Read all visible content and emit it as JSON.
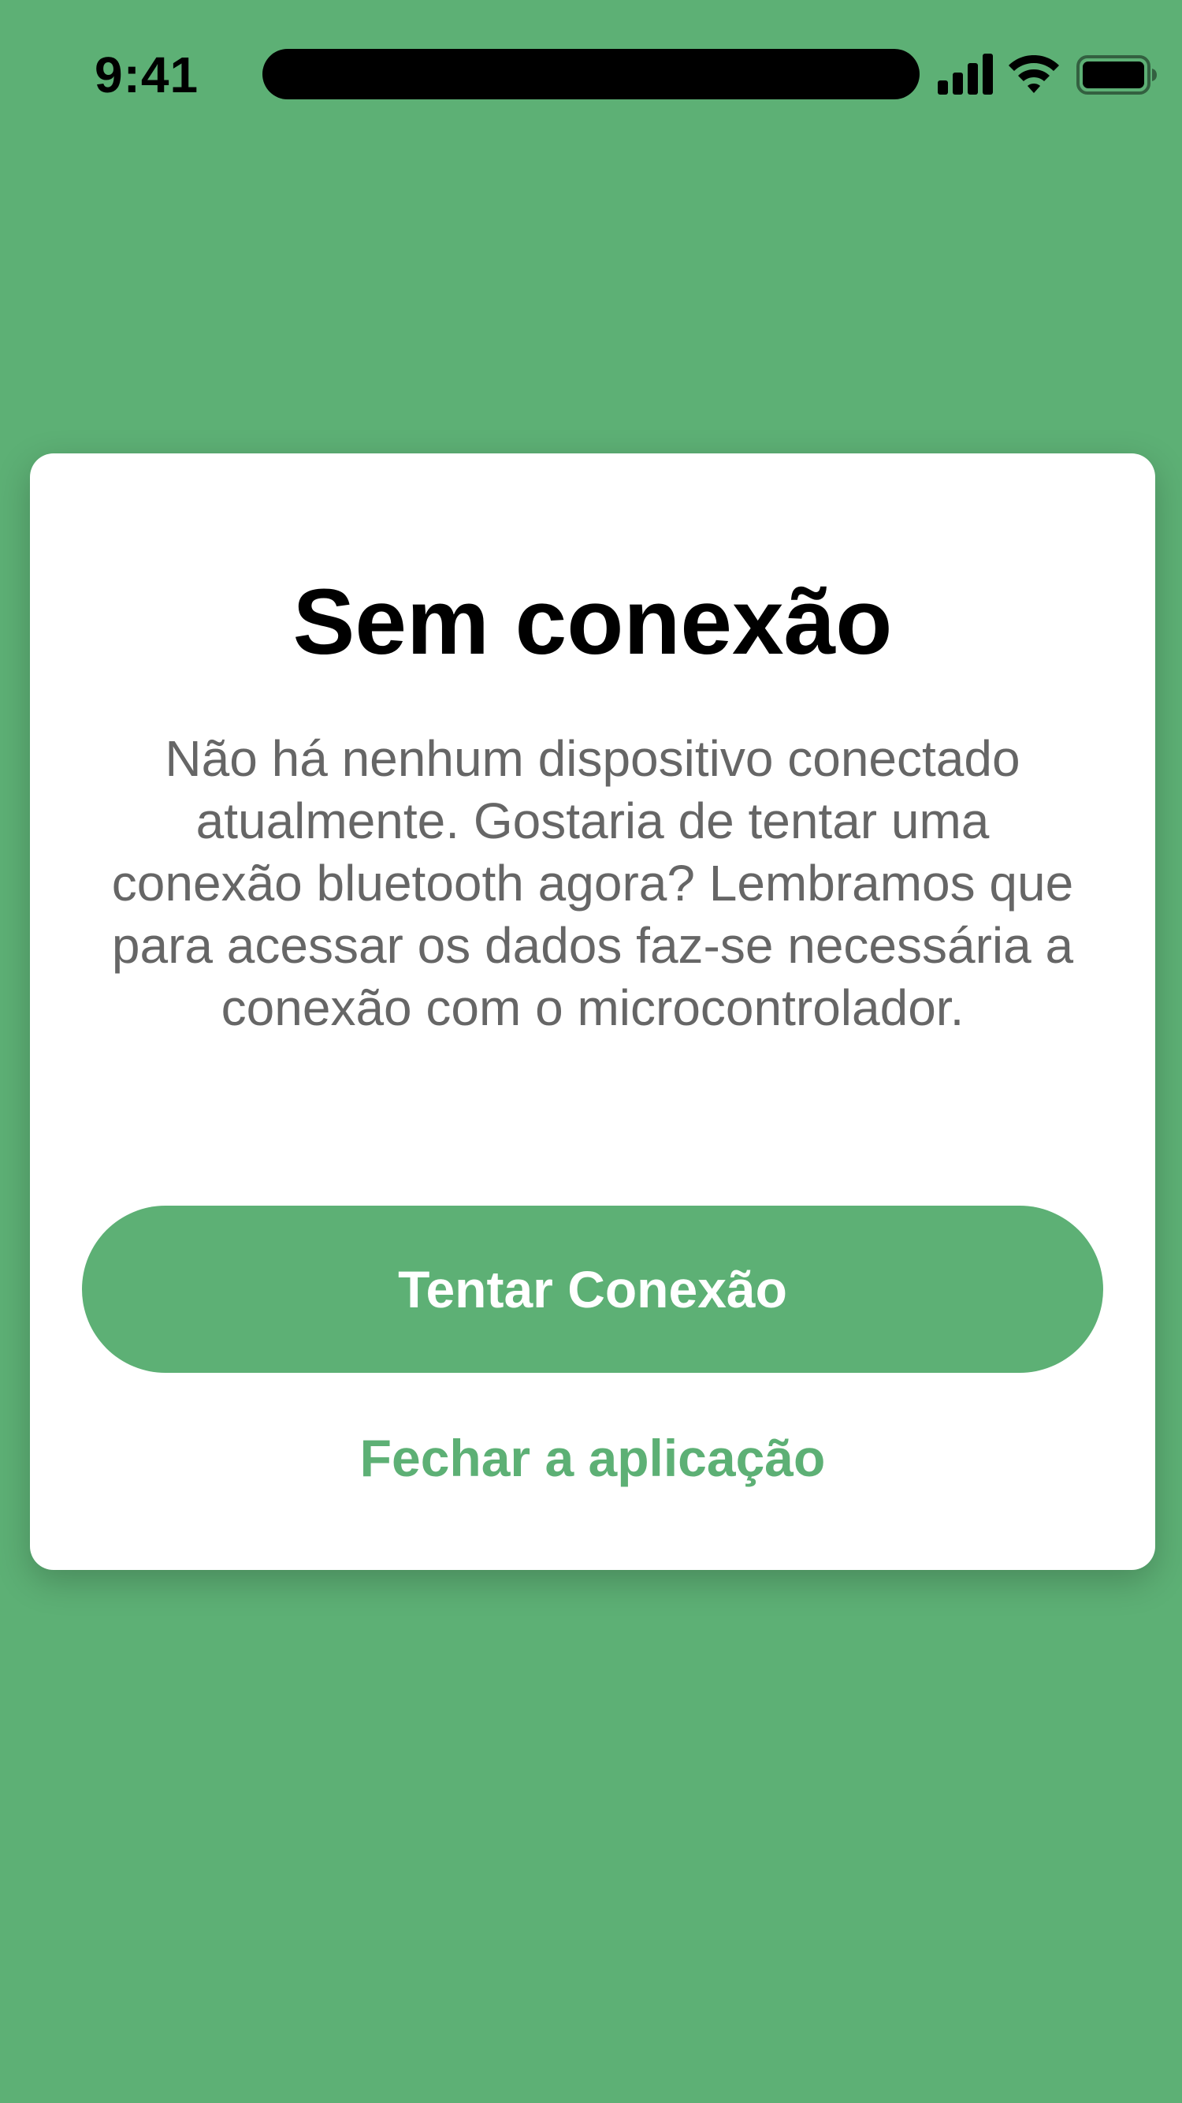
{
  "status_bar": {
    "time": "9:41",
    "icons": [
      "cellular-signal-icon",
      "wifi-icon",
      "battery-icon"
    ]
  },
  "dialog": {
    "title": "Sem conexão",
    "message": "Não há nenhum dispositivo conectado atualmente. Gostaria de tentar uma conexão bluetooth agora? Lembramos que para acessar os dados faz-se necessária a conexão com o microcontrolador.",
    "primary_button_label": "Tentar Conexão",
    "secondary_link_label": "Fechar a aplicação"
  },
  "colors": {
    "background": "#5db075",
    "accent": "#5db075",
    "card": "#ffffff",
    "title_text": "#000000",
    "body_text": "#666666"
  }
}
